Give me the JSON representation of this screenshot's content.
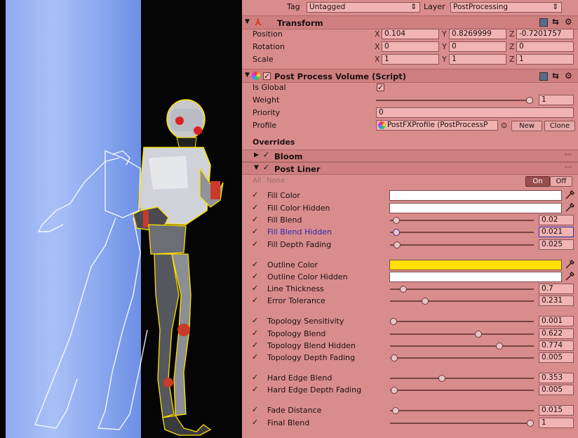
{
  "header": {
    "tag_label": "Tag",
    "tag_value": "Untagged",
    "layer_label": "Layer",
    "layer_value": "PostProcessing"
  },
  "transform": {
    "title": "Transform",
    "rows": [
      {
        "label": "Position",
        "x": "0.104",
        "y": "0.8269999",
        "z": "-0.7201757"
      },
      {
        "label": "Rotation",
        "x": "0",
        "y": "0",
        "z": "0"
      },
      {
        "label": "Scale",
        "x": "1",
        "y": "1",
        "z": "1"
      }
    ],
    "axis": {
      "x": "X",
      "y": "Y",
      "z": "Z"
    }
  },
  "volume": {
    "title": "Post Process Volume (Script)",
    "is_global_label": "Is Global",
    "weight_label": "Weight",
    "weight_value": "1",
    "weight_level": 1.0,
    "priority_label": "Priority",
    "priority_value": "0",
    "profile_label": "Profile",
    "profile_value": "PostFXProfile (PostProcessP",
    "new_button": "New",
    "clone_button": "Clone"
  },
  "overrides": {
    "title": "Overrides",
    "bloom": "Bloom",
    "post_liner": "Post Liner",
    "all_label": "All",
    "none_label": "None",
    "on_label": "On",
    "off_label": "Off"
  },
  "props": [
    {
      "label": "Fill Color",
      "type": "color",
      "color": "#ffffff"
    },
    {
      "label": "Fill Color Hidden",
      "type": "color",
      "color": "#ffffff"
    },
    {
      "label": "Fill Blend",
      "type": "slider",
      "value": "0.02",
      "level": 0.02
    },
    {
      "label": "Fill Blend Hidden",
      "type": "slider",
      "value": "0.021",
      "level": 0.021,
      "highlight": true
    },
    {
      "label": "Fill Depth Fading",
      "type": "slider",
      "value": "0.025",
      "level": 0.025
    },
    {
      "label": "Outline Color",
      "type": "color",
      "color": "#ffe000"
    },
    {
      "label": "Outline Color Hidden",
      "type": "color",
      "color": "#ffffff"
    },
    {
      "label": "Line Thickness",
      "type": "slider",
      "value": "0.7",
      "level": 0.07
    },
    {
      "label": "Error Tolerance",
      "type": "slider",
      "value": "0.231",
      "level": 0.231
    },
    {
      "label": "Topology Sensitivity",
      "type": "slider",
      "value": "0.001",
      "level": 0.001
    },
    {
      "label": "Topology Blend",
      "type": "slider",
      "value": "0.622",
      "level": 0.622
    },
    {
      "label": "Topology Blend Hidden",
      "type": "slider",
      "value": "0.774",
      "level": 0.774
    },
    {
      "label": "Topology Depth Fading",
      "type": "slider",
      "value": "0.005",
      "level": 0.005
    },
    {
      "label": "Hard Edge Blend",
      "type": "slider",
      "value": "0.353",
      "level": 0.353
    },
    {
      "label": "Hard Edge Depth Fading",
      "type": "slider",
      "value": "0.005",
      "level": 0.005
    },
    {
      "label": "Fade Distance",
      "type": "slider",
      "value": "0.015",
      "level": 0.015
    },
    {
      "label": "Final Blend",
      "type": "slider",
      "value": "1",
      "level": 1.0
    }
  ],
  "colors": {
    "inspector_bg": "#d98c8c",
    "outline": "#ffe000",
    "ghost_outline": "#ffffff"
  },
  "icons": {
    "help": "help-icon",
    "settings": "gear-icon",
    "presets": "preset-icon",
    "picker": "eyedropper-icon"
  }
}
